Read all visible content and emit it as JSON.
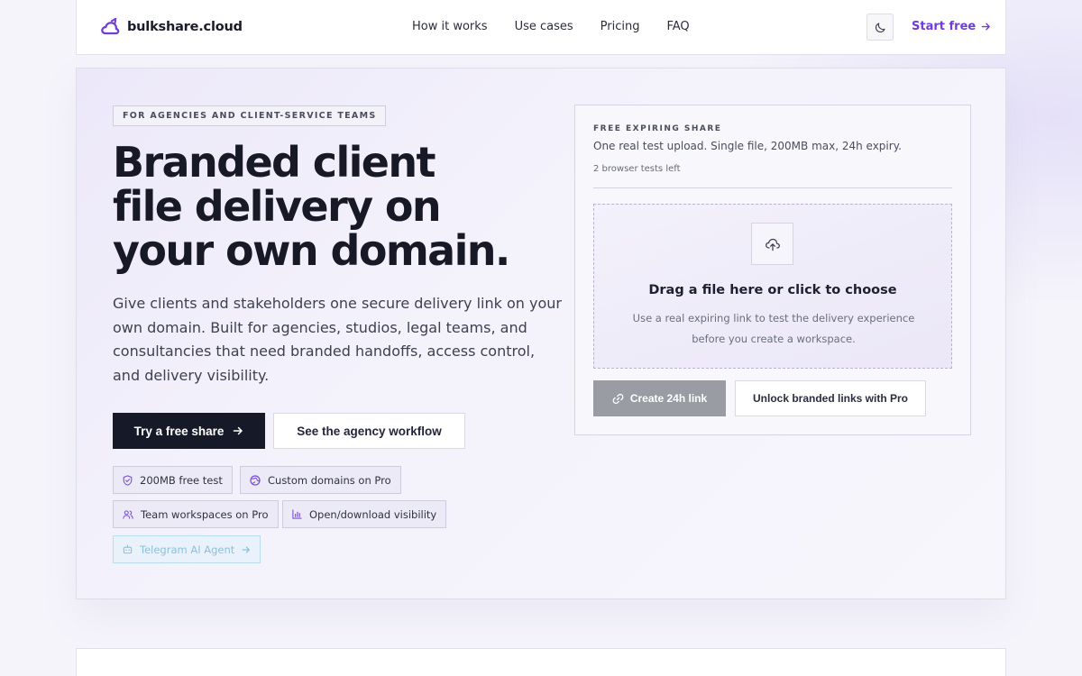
{
  "nav": {
    "brand": "bulkshare.cloud",
    "links": [
      "How it works",
      "Use cases",
      "Pricing",
      "FAQ"
    ],
    "start_free": "Start free",
    "theme_toggle_icon": "moon-icon"
  },
  "hero": {
    "eyebrow": "FOR AGENCIES AND CLIENT-SERVICE TEAMS",
    "headline_lines": [
      "Branded client",
      "file delivery on",
      "your own domain."
    ],
    "subtext": "Give clients and stakeholders one secure delivery link on your own domain. Built for agencies, studios, legal teams, and consultancies that need branded handoffs, access control, and delivery visibility.",
    "primary_cta": "Try a free share",
    "secondary_cta": "See the agency workflow",
    "chips": [
      {
        "label": "200MB free test",
        "icon": "shield-icon"
      },
      {
        "label": "Custom domains on Pro",
        "icon": "globe-icon"
      },
      {
        "label": "Team workspaces on Pro",
        "icon": "users-icon"
      },
      {
        "label": "Open/download visibility",
        "icon": "bar-chart-icon"
      },
      {
        "label": "Telegram AI Agent",
        "icon": "bot-icon"
      }
    ]
  },
  "share_panel": {
    "eyebrow": "FREE EXPIRING SHARE",
    "description": "One real test upload. Single file, 200MB max, 24h expiry.",
    "tests_left": "2 browser tests left",
    "drop_title": "Drag a file here or click to choose",
    "drop_desc": "Use a real expiring link to test the delivery experience before you create a workspace.",
    "create_button": "Create 24h link",
    "unlock_button": "Unlock branded links with Pro"
  },
  "colors": {
    "accent": "#6e3dd6",
    "dark_button": "#161a28",
    "disabled_button": "#9a9ca4"
  }
}
